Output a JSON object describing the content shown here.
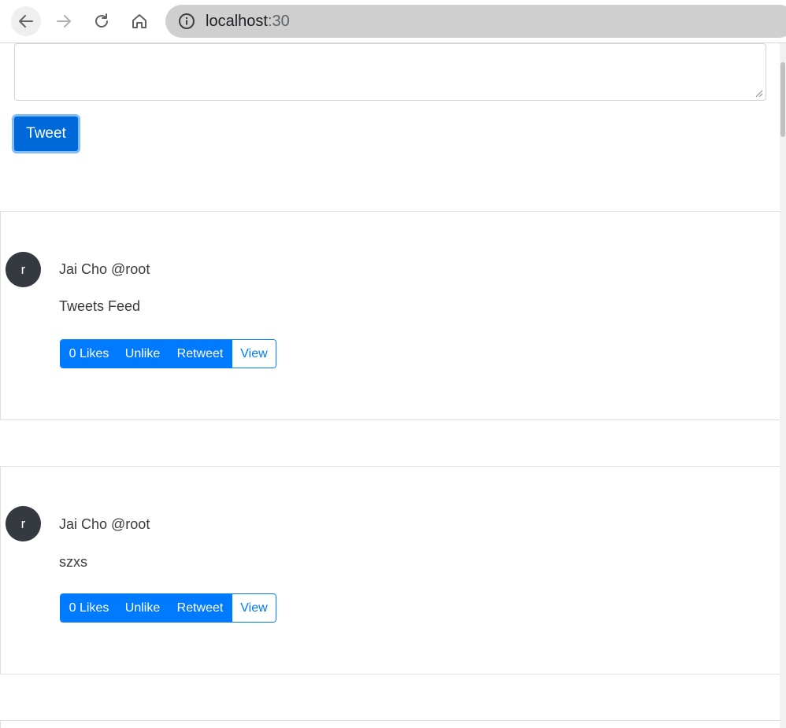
{
  "browser": {
    "url_host": "localhost",
    "url_port": ":30"
  },
  "compose": {
    "textarea_value": "",
    "tweet_button": "Tweet"
  },
  "feed": [
    {
      "avatar_letter": "r",
      "author": "Jai Cho @root",
      "text": "Tweets Feed",
      "likes_label": "0 Likes",
      "unlike_label": "Unlike",
      "retweet_label": "Retweet",
      "view_label": "View"
    },
    {
      "avatar_letter": "r",
      "author": "Jai Cho @root",
      "text": "szxs",
      "likes_label": "0 Likes",
      "unlike_label": "Unlike",
      "retweet_label": "Retweet",
      "view_label": "View"
    }
  ],
  "colors": {
    "primary": "#007bff",
    "tweet_button": "#0069d9",
    "avatar": "#343a40"
  }
}
